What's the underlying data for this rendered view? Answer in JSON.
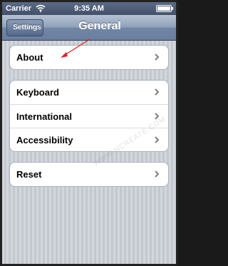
{
  "status_bar": {
    "carrier": "Carrier",
    "time": "9:35 AM",
    "battery_level": 1.0
  },
  "nav_bar": {
    "back_label": "Settings",
    "title": "General"
  },
  "groups": [
    {
      "items": [
        {
          "label": "About"
        }
      ]
    },
    {
      "items": [
        {
          "label": "Keyboard"
        },
        {
          "label": "International"
        },
        {
          "label": "Accessibility"
        }
      ]
    },
    {
      "items": [
        {
          "label": "Reset"
        }
      ]
    }
  ],
  "watermark": "WWW.NCREATE.COM",
  "colors": {
    "arrow": "#e02020",
    "nav_title": "#ffffff",
    "chevron": "#7f7f7f"
  },
  "icons": [
    "wifi-icon",
    "battery-icon",
    "chevron-right-icon"
  ]
}
